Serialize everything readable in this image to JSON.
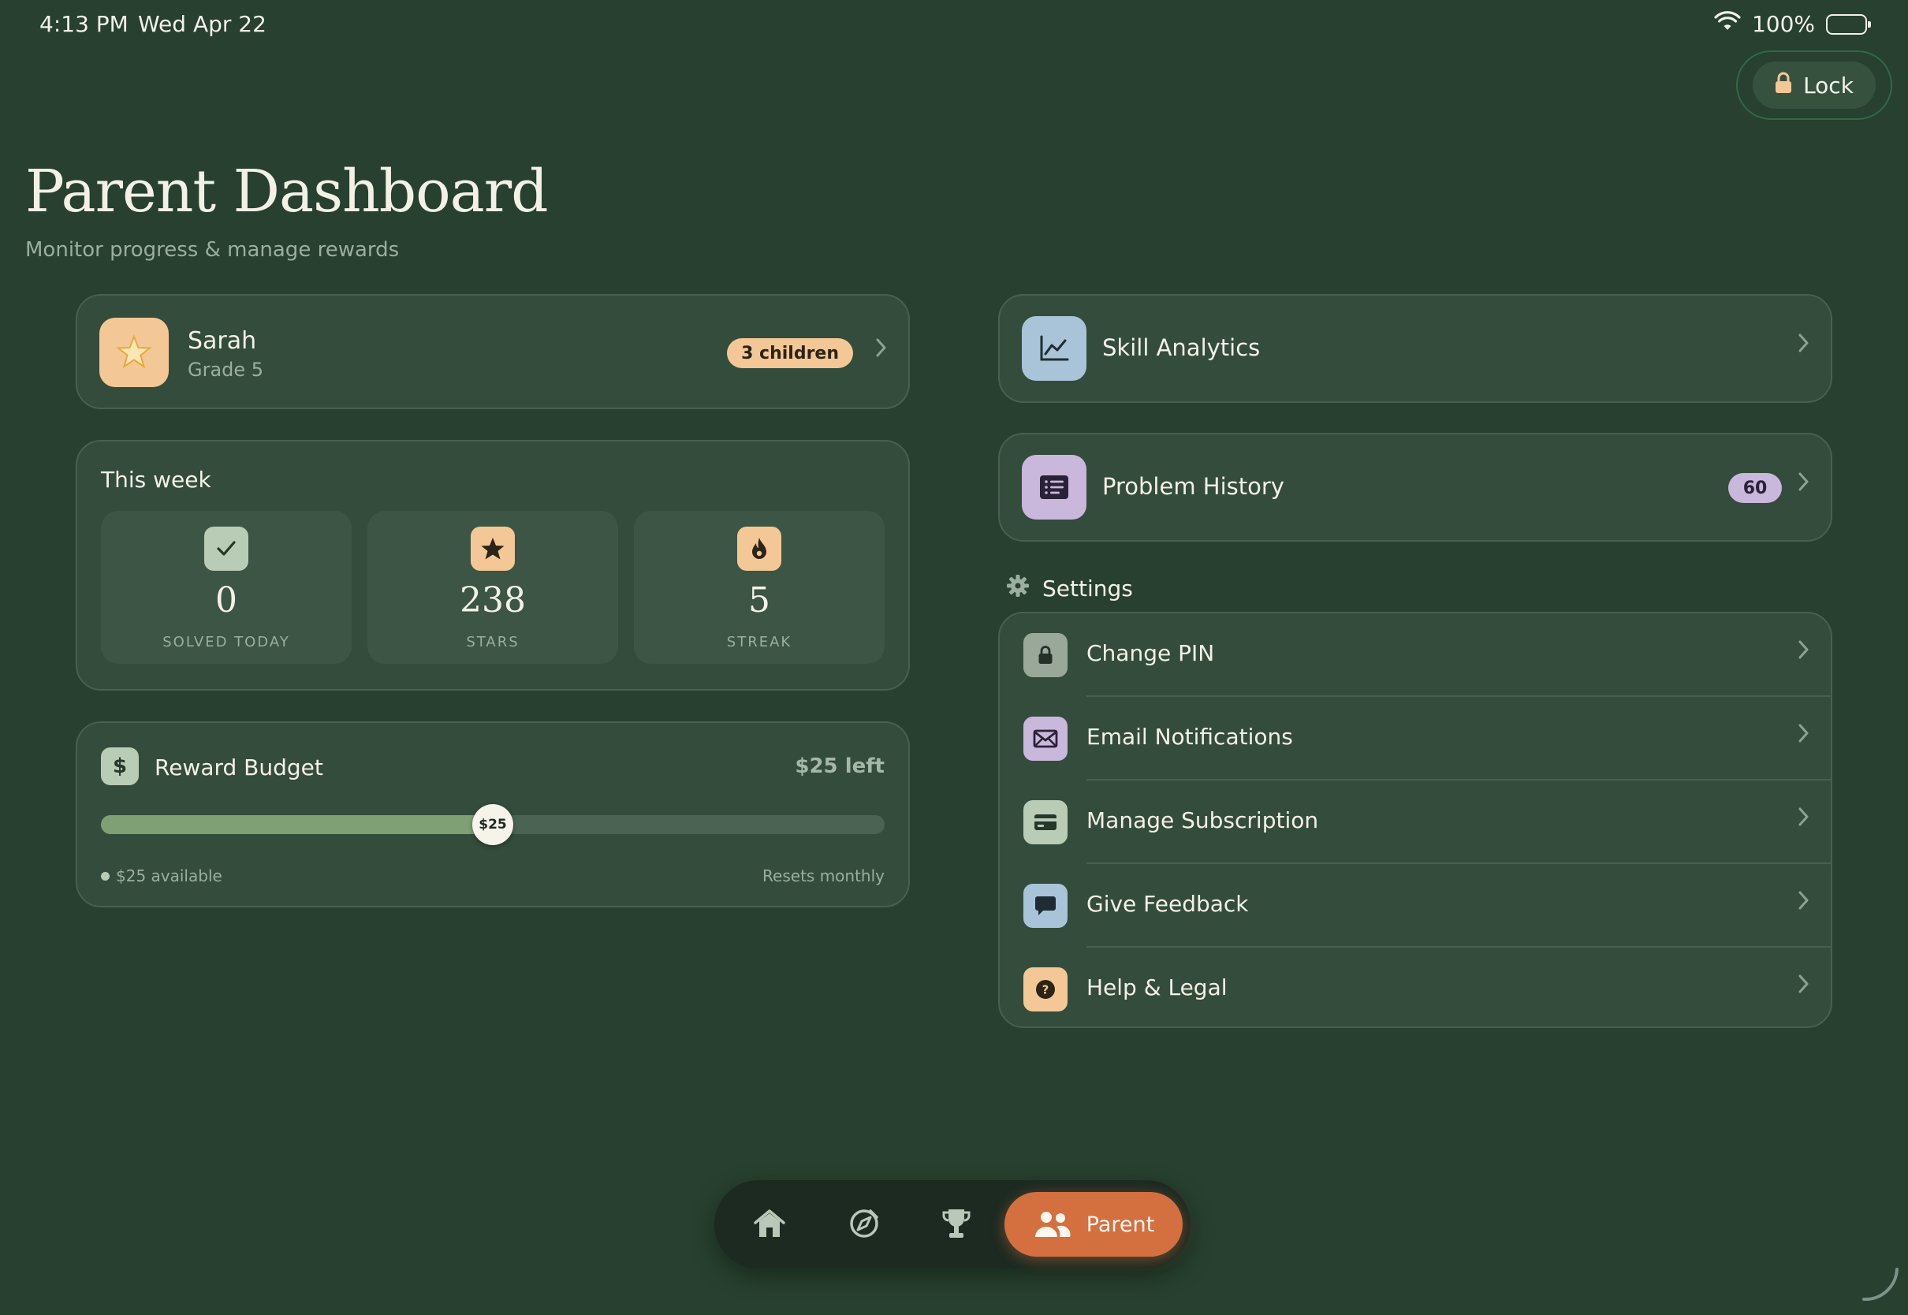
{
  "status_bar": {
    "time": "4:13 PM",
    "date": "Wed Apr 22",
    "battery": "100%"
  },
  "lock_button": {
    "label": "Lock"
  },
  "header": {
    "title": "Parent Dashboard",
    "subtitle": "Monitor progress & manage rewards"
  },
  "child": {
    "name": "Sarah",
    "grade": "Grade 5",
    "children_badge": "3 children"
  },
  "this_week": {
    "title": "This week",
    "stats": [
      {
        "value": "0",
        "label": "SOLVED TODAY",
        "icon": "check-icon",
        "color": "#b9ccb5"
      },
      {
        "value": "238",
        "label": "STARS",
        "icon": "star-icon",
        "color": "#f4c896"
      },
      {
        "value": "5",
        "label": "STREAK",
        "icon": "flame-icon",
        "color": "#f4c896"
      }
    ]
  },
  "reward_budget": {
    "title": "Reward Budget",
    "left_text": "$25 left",
    "slider_value_label": "$25",
    "slider_fraction": 0.5,
    "available_text": "$25 available",
    "resets_text": "Resets monthly"
  },
  "menu": {
    "skill_analytics": {
      "label": "Skill Analytics",
      "icon": "chart-icon",
      "color": "#a9c4d8"
    },
    "problem_history": {
      "label": "Problem History",
      "icon": "list-icon",
      "color": "#c9b7dc",
      "count": "60"
    }
  },
  "settings": {
    "title": "Settings",
    "items": [
      {
        "label": "Change PIN",
        "icon": "lock-icon",
        "color": "#9aa89a"
      },
      {
        "label": "Email Notifications",
        "icon": "mail-icon",
        "color": "#c9b7dc"
      },
      {
        "label": "Manage Subscription",
        "icon": "credit-card-icon",
        "color": "#b9ccb5"
      },
      {
        "label": "Give Feedback",
        "icon": "chat-bubble-icon",
        "color": "#a9c4d8"
      },
      {
        "label": "Help & Legal",
        "icon": "help-icon",
        "color": "#f4c896"
      }
    ]
  },
  "bottom_nav": {
    "items": [
      "home-icon",
      "compass-icon",
      "trophy-icon"
    ],
    "active": {
      "label": "Parent",
      "icon": "parents-icon",
      "color": "#d4703f"
    }
  },
  "colors": {
    "background": "#27402f",
    "card": "#344c3b",
    "accent": "#d4703f"
  }
}
